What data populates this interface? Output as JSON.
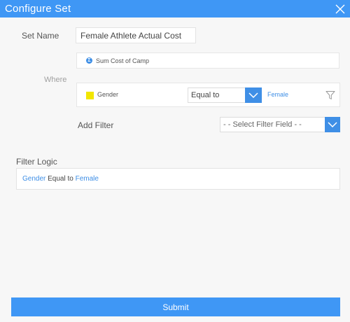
{
  "window": {
    "title": "Configure Set"
  },
  "form": {
    "set_name_label": "Set Name",
    "set_name_value": "Female Athlete Actual Cost",
    "metric_icon_letter": "Σ",
    "metric_label": "Sum Cost of Camp",
    "where_label": "Where",
    "condition": {
      "field": "Gender",
      "operator": "Equal to",
      "value": "Female",
      "swatch_color": "#f2e600"
    },
    "add_filter_label": "Add Filter",
    "add_filter_placeholder": "- - Select Filter Field - -"
  },
  "filter_logic": {
    "label": "Filter Logic",
    "field": "Gender",
    "operator": "Equal to",
    "value": "Female"
  },
  "actions": {
    "submit_label": "Submit"
  },
  "colors": {
    "accent": "#3f97f5",
    "link": "#3f8fe6",
    "swatch": "#f2e600"
  }
}
